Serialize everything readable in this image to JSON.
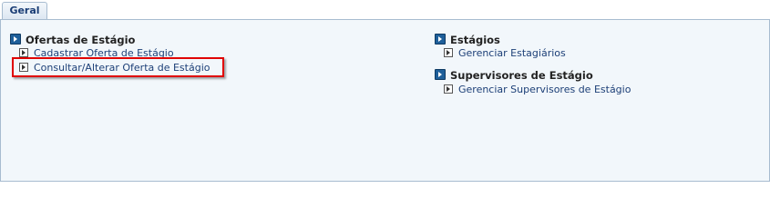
{
  "tabs": [
    {
      "label": "Geral",
      "active": true
    }
  ],
  "sections": {
    "ofertas": {
      "title": "Ofertas de Estágio",
      "items": [
        {
          "label": "Cadastrar Oferta de Estágio"
        },
        {
          "label": "Consultar/Alterar Oferta de Estágio",
          "highlighted": true
        }
      ]
    },
    "estagios": {
      "title": "Estágios",
      "items": [
        {
          "label": "Gerenciar Estagiários"
        }
      ]
    },
    "supervisores": {
      "title": "Supervisores de Estágio",
      "items": [
        {
          "label": "Gerenciar Supervisores de Estágio"
        }
      ]
    }
  },
  "colors": {
    "accent": "#1e5f9a",
    "link": "#1c3f77",
    "panel_bg": "#f2f7fb",
    "highlight_border": "#e00000"
  }
}
